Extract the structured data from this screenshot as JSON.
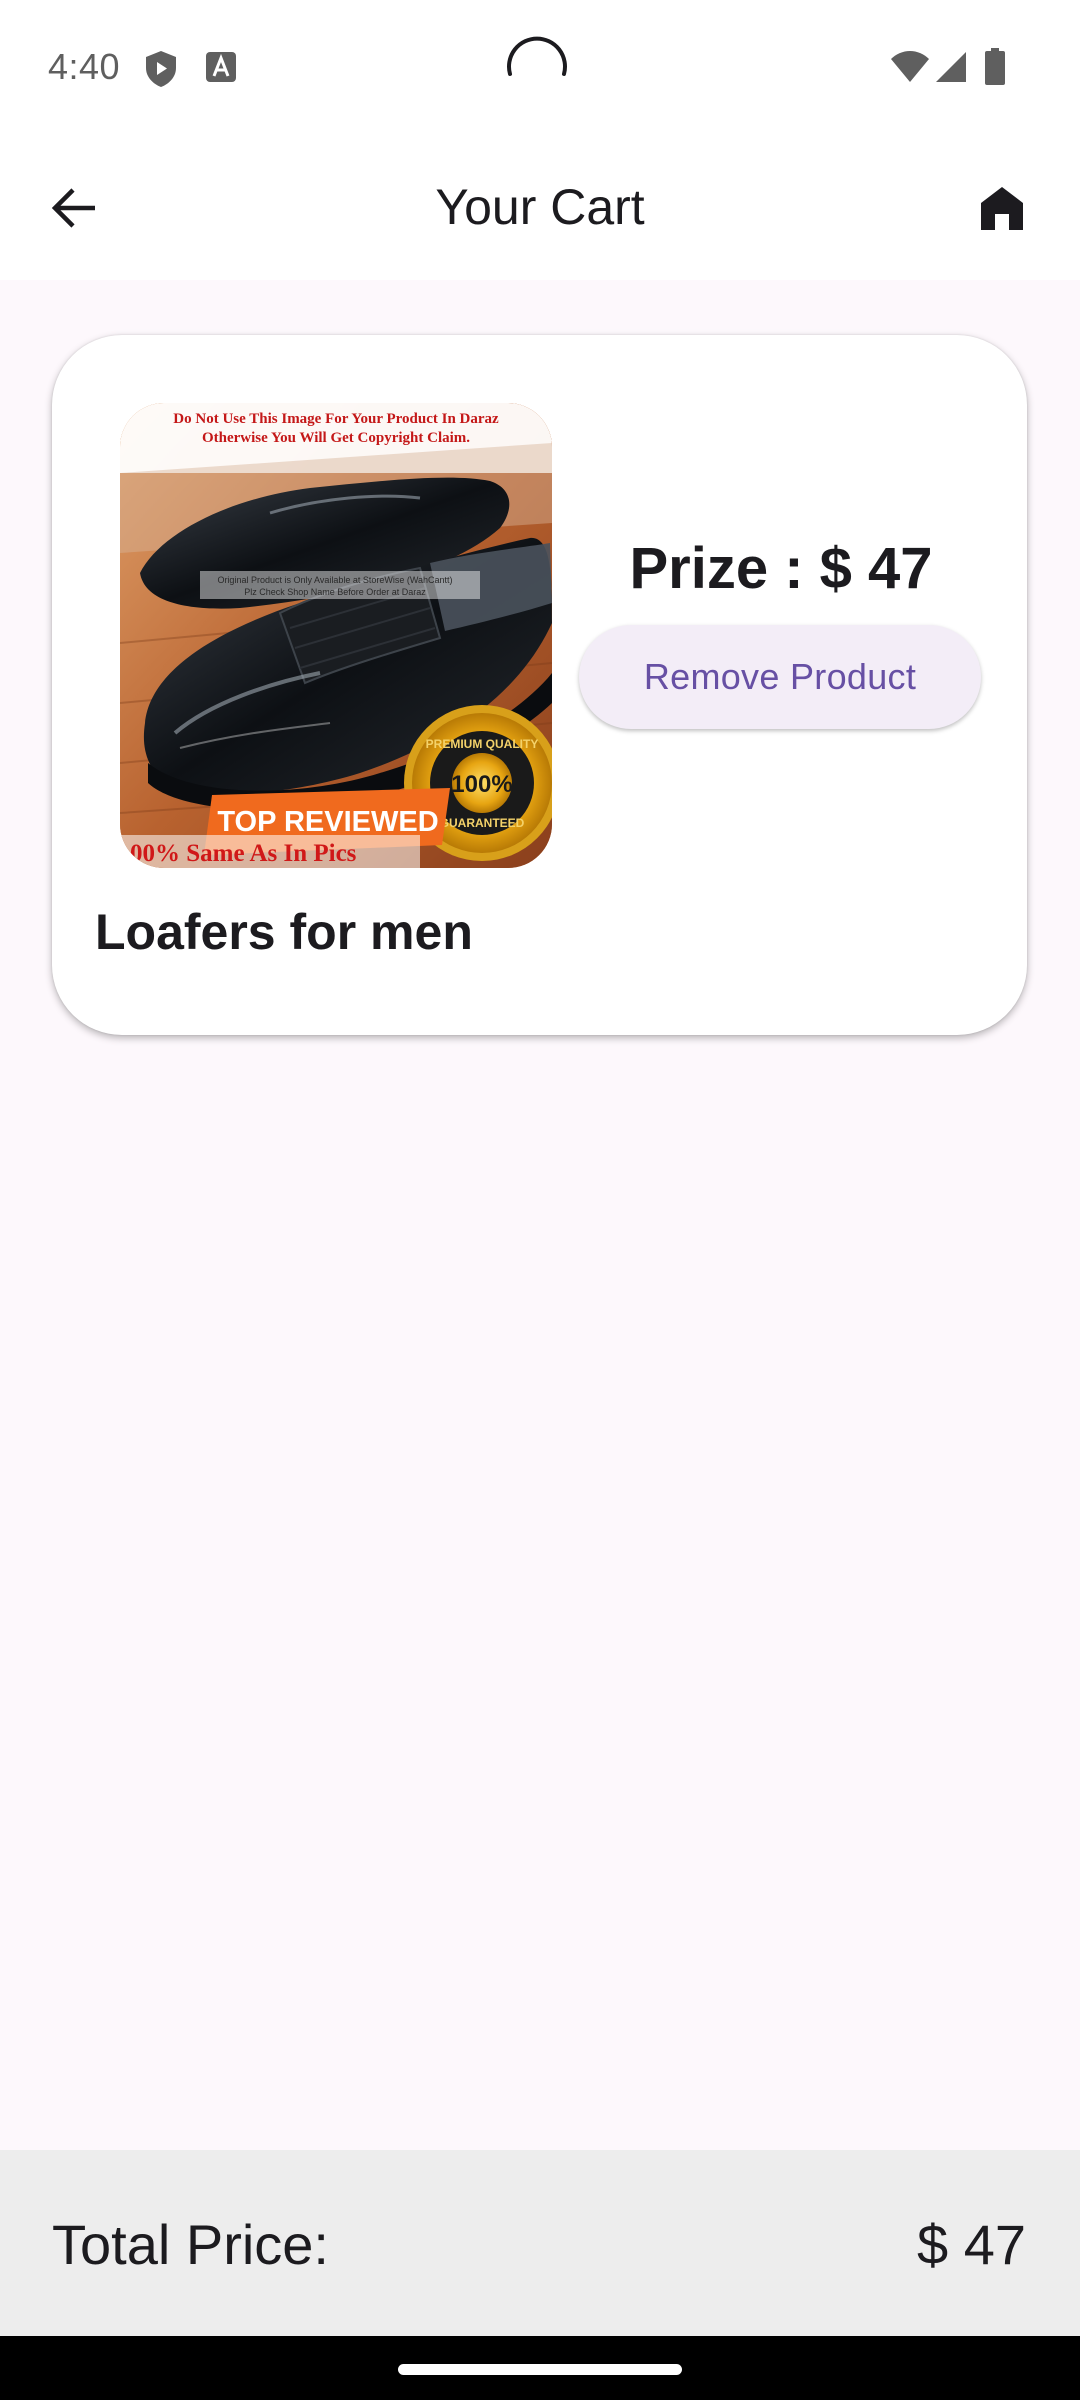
{
  "status_bar": {
    "time": "4:40",
    "icons": [
      "shield-icon",
      "keyboard-a-icon",
      "loading-icon",
      "wifi-icon",
      "signal-icon",
      "battery-icon"
    ]
  },
  "app_bar": {
    "title": "Your Cart",
    "back_icon": "arrow-back-icon",
    "home_icon": "home-icon"
  },
  "cart": {
    "items": [
      {
        "name": "Loafers for men",
        "price_text": "Prize : $ 47",
        "remove_label": "Remove Product",
        "image": {
          "top_text_line1": "Do Not Use This Image For Your Product In Daraz",
          "top_text_line2": "Otherwise You Will Get Copyright Claim.",
          "mid_text_line1": "Original Product is Only Available at StoreWise (WahCantt)",
          "mid_text_line2": "Plz Check Shop Name Before Order at Daraz",
          "banner": "TOP REVIEWED",
          "bottom_text": "00% Same As In Pics",
          "seal_top": "PREMIUM QUALITY",
          "seal_center": "100%",
          "seal_bottom": "GUARANTEED"
        }
      }
    ]
  },
  "total": {
    "label": "Total Price:",
    "value": "$ 47"
  },
  "colors": {
    "accent": "#6750a4",
    "button_bg": "#f3edf7",
    "page_bg": "#fdf8fc",
    "total_bar_bg": "#ededed"
  }
}
